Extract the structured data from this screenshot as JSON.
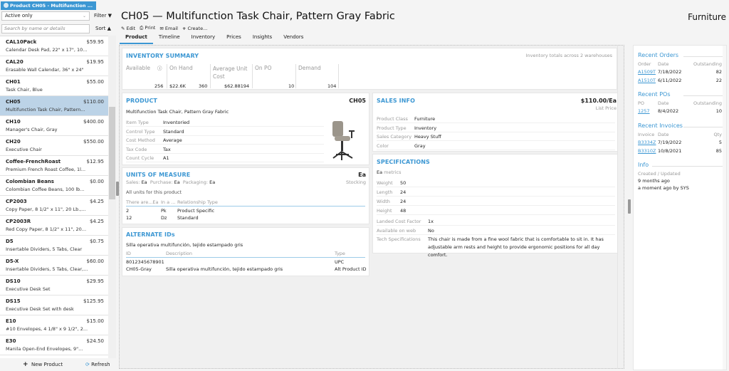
{
  "window": {
    "tab_title": "Product CH05 - Multifunction ..."
  },
  "left": {
    "filter_value": "Active only",
    "filter_label": "Filter",
    "search_placeholder": "Search by name or details",
    "sort_label": "Sort",
    "items": [
      {
        "code": "CAL10Pack",
        "price": "$59.95",
        "desc": "Calendar Desk Pad, 22\" x 17\", 10..."
      },
      {
        "code": "CAL20",
        "price": "$19.95",
        "desc": "Erasable Wall Calendar, 36\" x 24\""
      },
      {
        "code": "CH01",
        "price": "$55.00",
        "desc": "Task Chair, Blue"
      },
      {
        "code": "CH05",
        "price": "$110.00",
        "desc": "Multifunction Task Chair, Pattern..."
      },
      {
        "code": "CH10",
        "price": "$400.00",
        "desc": "Manager's Chair, Gray"
      },
      {
        "code": "CH20",
        "price": "$550.00",
        "desc": "Executive Chair"
      },
      {
        "code": "Coffee-FrenchRoast",
        "price": "$12.95",
        "desc": "Premium French Roast Coffee, 1l..."
      },
      {
        "code": "Colombian Beans",
        "price": "$0.00",
        "desc": "Colombian Coffee Beans, 100 lb..."
      },
      {
        "code": "CP2003",
        "price": "$4.25",
        "desc": "Copy Paper, 8 1/2\" x 11\", 20 Lb.,..."
      },
      {
        "code": "CP2003R",
        "price": "$4.25",
        "desc": "Red Copy Paper, 8 1/2\" x 11\", 20..."
      },
      {
        "code": "D5",
        "price": "$0.75",
        "desc": "Insertable Dividers, 5 Tabs, Clear"
      },
      {
        "code": "D5-X",
        "price": "$60.00",
        "desc": "Insertable Dividers, 5 Tabs, Clear,..."
      },
      {
        "code": "DS10",
        "price": "$29.95",
        "desc": "Executive Desk Set"
      },
      {
        "code": "DS15",
        "price": "$125.95",
        "desc": "Executive Desk Set with desk"
      },
      {
        "code": "E10",
        "price": "$15.00",
        "desc": "#10 Envelopes, 4 1/8\" x 9 1/2\", 2..."
      },
      {
        "code": "E30",
        "price": "$24.50",
        "desc": "Manila Open-End Envelopes, 9\"..."
      }
    ],
    "new_product": "New Product",
    "refresh": "Refresh"
  },
  "header": {
    "title": "CH05 — Multifunction Task Chair, Pattern Gray Fabric",
    "category": "Furniture",
    "toolbar": {
      "edit": "Edit",
      "print": "Print",
      "email": "Email",
      "create": "Create..."
    },
    "tabs": [
      "Product",
      "Timeline",
      "Inventory",
      "Prices",
      "Insights",
      "Vendors"
    ]
  },
  "inventory": {
    "heading": "INVENTORY SUMMARY",
    "note": "Inventory totals across 2 warehouses",
    "available_label": "Available",
    "available": "256",
    "onhand_label": "On Hand",
    "onhand_value": "$22.6K",
    "onhand_qty": "360",
    "avg_label": "Average Unit Cost",
    "avg": "$62.88194",
    "onpo_label": "On PO",
    "onpo": "10",
    "demand_label": "Demand",
    "demand": "104"
  },
  "product": {
    "heading": "PRODUCT",
    "code": "CH05",
    "desc": "Multifunction Task Chair, Pattern Gray Fabric",
    "fields": [
      {
        "label": "Item Type",
        "value": "Inventoried"
      },
      {
        "label": "Control Type",
        "value": "Standard"
      },
      {
        "label": "Cost Method",
        "value": "Average"
      },
      {
        "label": "Tax Code",
        "value": "Tax"
      },
      {
        "label": "Count Cycle",
        "value": "A1"
      }
    ]
  },
  "uom": {
    "heading": "UNITS OF MEASURE",
    "unit": "Ea",
    "stocking": "Stocking",
    "sales_label": "Sales:",
    "sales": "Ea",
    "purchase_label": "Purchase:",
    "purchase": "Ea",
    "pack_label": "Packaging:",
    "pack": "Ea",
    "all_units": "All units for this product",
    "cols": [
      "There are...Ea",
      "In a ...",
      "Relationship Type"
    ],
    "rows": [
      [
        "2",
        "Pk",
        "Product Specific"
      ],
      [
        "12",
        "Dz",
        "Standard"
      ]
    ]
  },
  "alt": {
    "heading": "ALTERNATE IDs",
    "desc": "Silla operativa multifunción, tejido estampado gris",
    "cols": [
      "ID",
      "Description",
      "Type"
    ],
    "rows": [
      [
        "8012345678901",
        "",
        "UPC"
      ],
      [
        "CH05-Gray",
        "Silla operativa multifunción, tejido estampado gris",
        "Alt Product ID"
      ]
    ]
  },
  "sales": {
    "heading": "SALES INFO",
    "price": "$110.00/Ea",
    "price_label": "List Price",
    "fields": [
      {
        "label": "Product Class",
        "value": "Furniture"
      },
      {
        "label": "Product Type",
        "value": "Inventory"
      },
      {
        "label": "Sales Category",
        "value": "Heavy Stuff"
      },
      {
        "label": "Color",
        "value": "Gray"
      }
    ]
  },
  "specs": {
    "heading": "SPECIFICATIONS",
    "unit": "Ea",
    "metrics": "metrics",
    "dims": [
      {
        "label": "Weight",
        "value": "50"
      },
      {
        "label": "Length",
        "value": "24"
      },
      {
        "label": "Width",
        "value": "24"
      },
      {
        "label": "Height",
        "value": "48"
      }
    ],
    "other": [
      {
        "label": "Landed Cost Factor",
        "value": "1x"
      },
      {
        "label": "Available on web",
        "value": "No"
      },
      {
        "label": "Tech Specifications",
        "value": "This chair is made from a fine wool fabric that is comfortable to sit in. It has adjustable arm rests and height to provide ergonomic positions for all day comfort."
      }
    ]
  },
  "right": {
    "orders": {
      "heading": "Recent Orders",
      "cols": [
        "Order",
        "Date",
        "Outstanding"
      ],
      "rows": [
        [
          "A1509T",
          "7/18/2022",
          "82"
        ],
        [
          "A1510T",
          "6/11/2022",
          "22"
        ]
      ]
    },
    "pos": {
      "heading": "Recent POs",
      "cols": [
        "PO",
        "Date",
        "Outstanding"
      ],
      "rows": [
        [
          "1257",
          "8/4/2022",
          "10"
        ]
      ]
    },
    "invoices": {
      "heading": "Recent Invoices",
      "cols": [
        "Invoice",
        "Date",
        "Qty"
      ],
      "rows": [
        [
          "B3334Z",
          "7/19/2022",
          "5"
        ],
        [
          "B3310Z",
          "10/8/2021",
          "85"
        ]
      ]
    },
    "info": {
      "heading": "Info",
      "label": "Created / Updated",
      "created": "9 months ago",
      "updated": "a moment ago by SYS"
    }
  },
  "colors": {
    "accent": "#3c97d3",
    "selected_row": "#bcd3e7"
  }
}
